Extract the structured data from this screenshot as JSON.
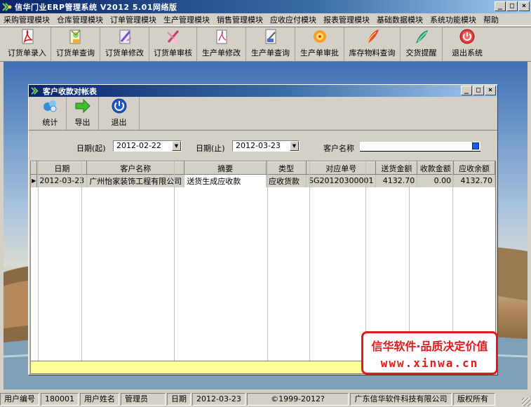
{
  "app": {
    "title": "信华门业ERP管理系统   V2012   5.01网络版"
  },
  "menu": [
    "采购管理模块",
    "仓库管理模块",
    "订单管理模块",
    "生产管理模块",
    "销售管理模块",
    "应收应付模块",
    "报表管理模块",
    "基础数据模块",
    "系统功能模块",
    "帮助"
  ],
  "toolbar": [
    {
      "label": "订货单录入",
      "icon": "document-pdf-icon"
    },
    {
      "label": "订货单查询",
      "icon": "flower-document-icon"
    },
    {
      "label": "订货单修改",
      "icon": "pen-document-icon"
    },
    {
      "label": "订货单审核",
      "icon": "pen-check-icon"
    },
    {
      "label": "生产单修改",
      "icon": "document-edit-icon"
    },
    {
      "label": "生产单查询",
      "icon": "document-search-icon"
    },
    {
      "label": "生产单审批",
      "icon": "flower-icon"
    },
    {
      "label": "库存物料查询",
      "icon": "feather-icon"
    },
    {
      "label": "交货提醒",
      "icon": "quill-icon"
    },
    {
      "label": "退出系统",
      "icon": "exit-icon"
    }
  ],
  "child": {
    "title": "客户收款对帐表",
    "tools": [
      {
        "label": "统计",
        "icon": "stats-icon"
      },
      {
        "label": "导出",
        "icon": "arrow-right-icon"
      },
      {
        "label": "退出",
        "icon": "power-icon"
      }
    ],
    "filter": {
      "date_from_label": "日期(起)",
      "date_from": "2012-02-22",
      "date_to_label": "日期(止)",
      "date_to": "2012-03-23",
      "customer_label": "客户名称",
      "customer": ""
    },
    "columns": [
      "日期",
      "客户名称",
      "摘要",
      "类型",
      "对应单号",
      "送货金额",
      "收款金额",
      "应收余额"
    ],
    "rows": [
      [
        "2012-03-23",
        "广州怡家装饰工程有限公司",
        "送货生成应收款",
        "应收货款",
        "SG20120300001",
        "4132.70",
        "0.00",
        "4132.70"
      ]
    ]
  },
  "watermark": {
    "line1": "信华软件·品质决定价值",
    "line2": "www.xinwa.cn"
  },
  "status": {
    "user_no_label": "用户编号",
    "user_no": "180001",
    "user_name_label": "用户姓名",
    "user_name": "管理员",
    "date_label": "日期",
    "date": "2012-03-23",
    "copyright": "©1999-2012?",
    "company": "广东信华软件科技有限公司",
    "rights": "版权所有"
  },
  "colors": {
    "title_dark": "#0a246a",
    "title_light": "#a6caf0",
    "face": "#d4d0c8",
    "sum_row": "#ffff99",
    "watermark": "#e01b1b"
  }
}
